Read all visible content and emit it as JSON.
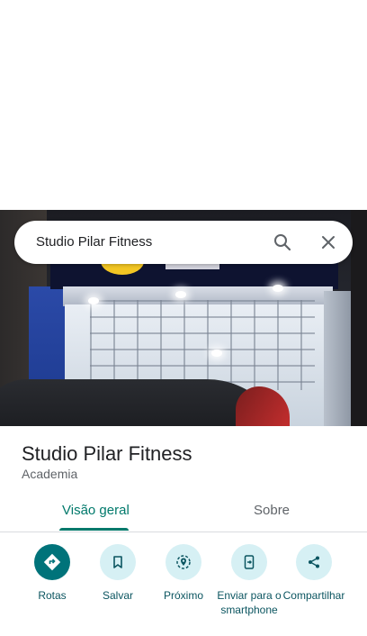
{
  "search": {
    "query": "Studio Pilar Fitness"
  },
  "place": {
    "name": "Studio Pilar Fitness",
    "category": "Academia"
  },
  "tabs": [
    {
      "label": "Visão geral",
      "selected": true
    },
    {
      "label": "Sobre",
      "selected": false
    }
  ],
  "actions": [
    {
      "label": "Rotas",
      "icon": "directions-icon"
    },
    {
      "label": "Salvar",
      "icon": "bookmark-icon"
    },
    {
      "label": "Próximo",
      "icon": "nearby-icon"
    },
    {
      "label": "Enviar para o smartphone",
      "icon": "send-to-phone-icon"
    },
    {
      "label": "Compartilhar",
      "icon": "share-icon"
    }
  ],
  "colors": {
    "accent": "#00796b",
    "action_bg": "#d6f0f4",
    "primary_action_bg": "#00737a"
  }
}
